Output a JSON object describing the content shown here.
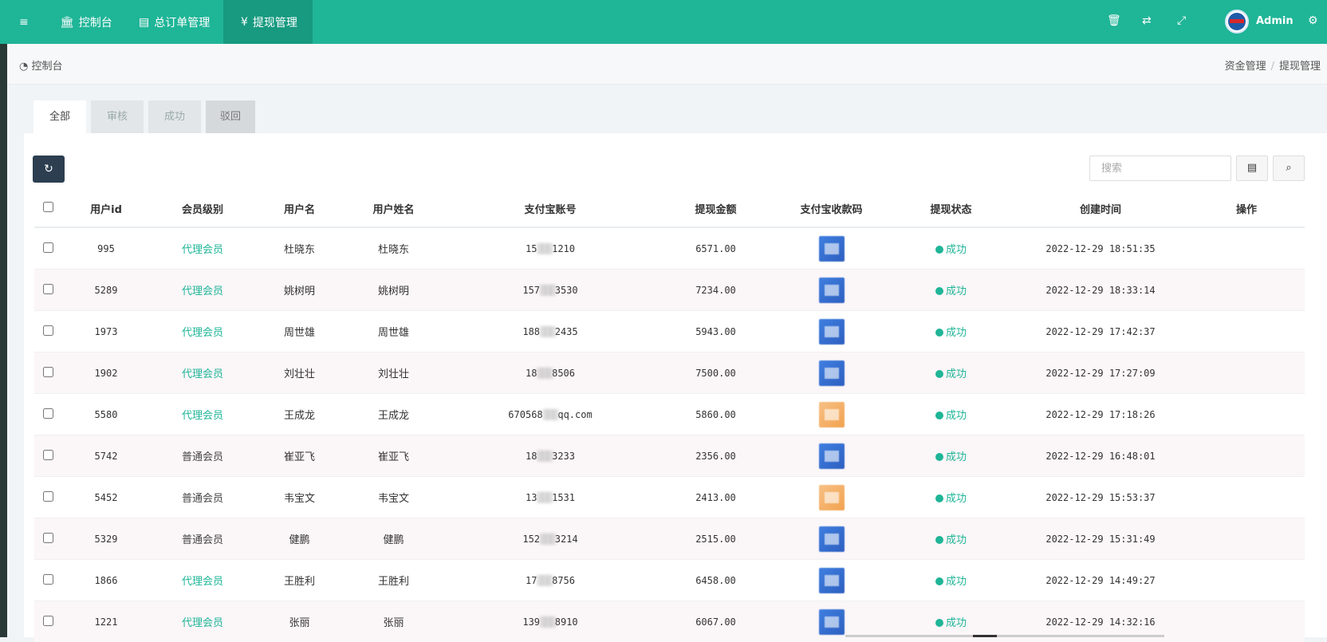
{
  "topbar": {
    "menu_icon": "menu-icon",
    "nav": [
      {
        "label": "控制台",
        "icon": "bank-icon"
      },
      {
        "label": "总订单管理",
        "icon": "document-icon"
      },
      {
        "label": "提现管理",
        "icon": "yen-icon"
      }
    ],
    "user": "Admin",
    "icons": [
      "trash-icon",
      "translate-icon",
      "fullscreen-icon",
      "gears-icon"
    ]
  },
  "breadcrumb": {
    "left": "控制台",
    "right": [
      "资金管理",
      "提现管理"
    ]
  },
  "tabs": [
    "全部",
    "审核",
    "成功",
    "驳回"
  ],
  "toolbar": {
    "search_placeholder": "搜索"
  },
  "table": {
    "columns": [
      "用户id",
      "会员级别",
      "用户名",
      "用户姓名",
      "支付宝账号",
      "提现金额",
      "支付宝收款码",
      "提现状态",
      "创建时间",
      "操作"
    ],
    "rows": [
      {
        "id": "995",
        "level": "代理会员",
        "username": "杜晓东",
        "name": "杜晓东",
        "acc_pre": "15",
        "acc_suf": "1210",
        "amount": "6571.00",
        "qr": "blue",
        "status": "成功",
        "time": "2022-12-29 18:51:35"
      },
      {
        "id": "5289",
        "level": "代理会员",
        "username": "姚树明",
        "name": "姚树明",
        "acc_pre": "157",
        "acc_suf": "3530",
        "amount": "7234.00",
        "qr": "blue",
        "status": "成功",
        "time": "2022-12-29 18:33:14"
      },
      {
        "id": "1973",
        "level": "代理会员",
        "username": "周世雄",
        "name": "周世雄",
        "acc_pre": "188",
        "acc_suf": "2435",
        "amount": "5943.00",
        "qr": "blue",
        "status": "成功",
        "time": "2022-12-29 17:42:37"
      },
      {
        "id": "1902",
        "level": "代理会员",
        "username": "刘壮壮",
        "name": "刘壮壮",
        "acc_pre": "18",
        "acc_suf": "8506",
        "amount": "7500.00",
        "qr": "blue",
        "status": "成功",
        "time": "2022-12-29 17:27:09"
      },
      {
        "id": "5580",
        "level": "代理会员",
        "username": "王成龙",
        "name": "王成龙",
        "acc_pre": "670568",
        "acc_suf": "qq.com",
        "amount": "5860.00",
        "qr": "orange",
        "status": "成功",
        "time": "2022-12-29 17:18:26"
      },
      {
        "id": "5742",
        "level": "普通会员",
        "username": "崔亚飞",
        "name": "崔亚飞",
        "acc_pre": "18",
        "acc_suf": "3233",
        "amount": "2356.00",
        "qr": "blue",
        "status": "成功",
        "time": "2022-12-29 16:48:01"
      },
      {
        "id": "5452",
        "level": "普通会员",
        "username": "韦宝文",
        "name": "韦宝文",
        "acc_pre": "13",
        "acc_suf": "1531",
        "amount": "2413.00",
        "qr": "orange",
        "status": "成功",
        "time": "2022-12-29 15:53:37"
      },
      {
        "id": "5329",
        "level": "普通会员",
        "username": "健鹏",
        "name": "健鹏",
        "acc_pre": "152",
        "acc_suf": "3214",
        "amount": "2515.00",
        "qr": "blue",
        "status": "成功",
        "time": "2022-12-29 15:31:49"
      },
      {
        "id": "1866",
        "level": "代理会员",
        "username": "王胜利",
        "name": "王胜利",
        "acc_pre": "17",
        "acc_suf": "8756",
        "amount": "6458.00",
        "qr": "blue",
        "status": "成功",
        "time": "2022-12-29 14:49:27"
      },
      {
        "id": "1221",
        "level": "代理会员",
        "username": "张丽",
        "name": "张丽",
        "acc_pre": "139",
        "acc_suf": "8910",
        "amount": "6067.00",
        "qr": "blue",
        "status": "成功",
        "time": "2022-12-29 14:32:16"
      }
    ]
  },
  "colors": {
    "brand": "#1fb597",
    "dark_button": "#2c3e50"
  }
}
